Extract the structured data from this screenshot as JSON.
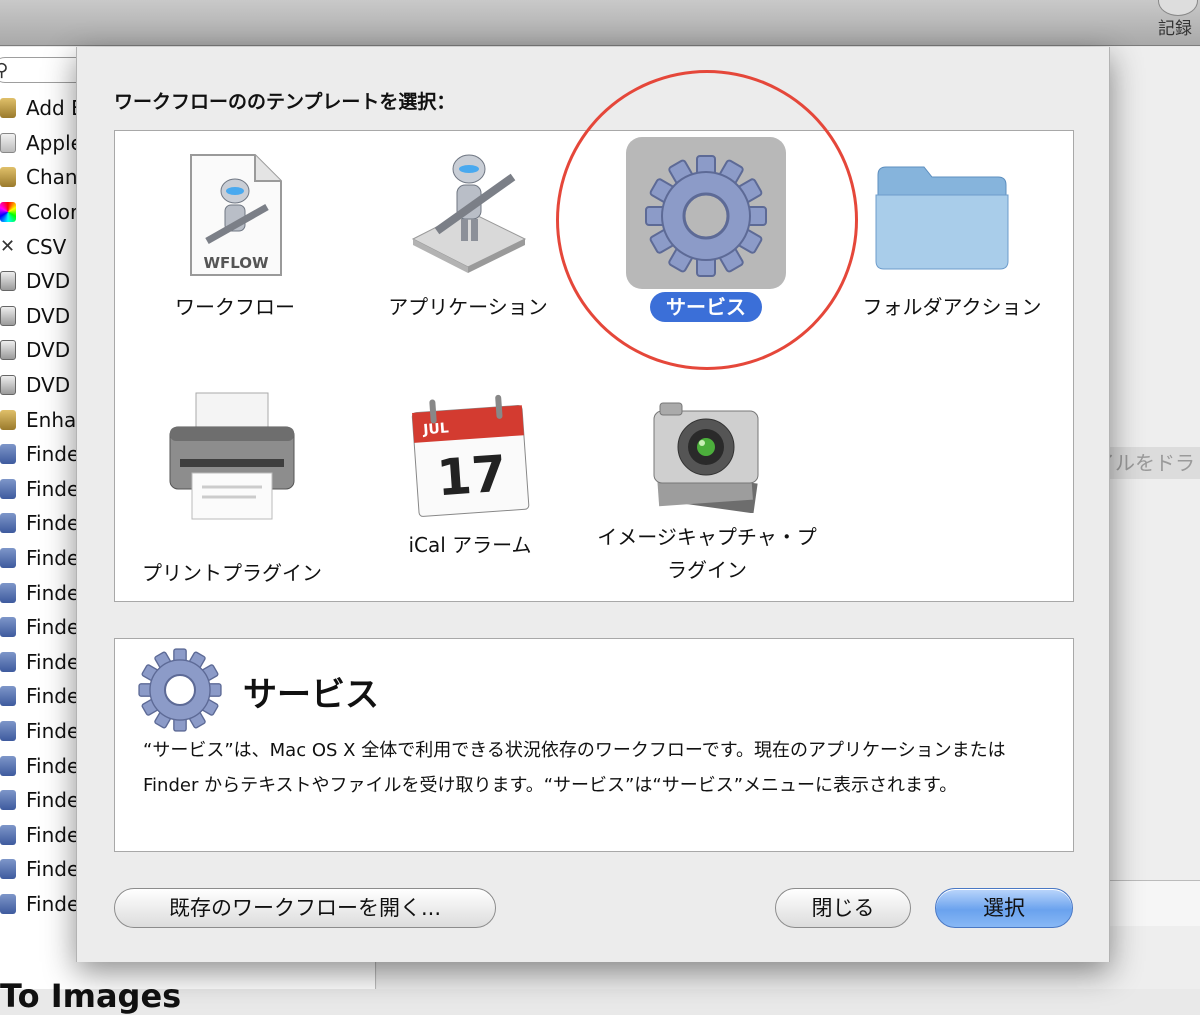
{
  "window": {
    "record_label": "記録"
  },
  "sidebar": {
    "items": [
      {
        "label": "Add E",
        "icon": "robot-icon"
      },
      {
        "label": "Apple",
        "icon": "script-icon"
      },
      {
        "label": "Chang",
        "icon": "robot-icon"
      },
      {
        "label": "Color",
        "icon": "color-icon"
      },
      {
        "label": "CSV",
        "icon": "csv-icon"
      },
      {
        "label": "DVD",
        "icon": "dvd-icon"
      },
      {
        "label": "DVD",
        "icon": "dvd-icon"
      },
      {
        "label": "DVD",
        "icon": "dvd-icon"
      },
      {
        "label": "DVD",
        "icon": "dvd-icon"
      },
      {
        "label": "Enhar",
        "icon": "robot-icon"
      },
      {
        "label": "Finde",
        "icon": "finder-icon"
      },
      {
        "label": "Finde",
        "icon": "finder-icon"
      },
      {
        "label": "Finde",
        "icon": "finder-icon"
      },
      {
        "label": "Finde",
        "icon": "finder-icon"
      },
      {
        "label": "Finde",
        "icon": "finder-icon"
      },
      {
        "label": "Finde",
        "icon": "finder-icon"
      },
      {
        "label": "Finde",
        "icon": "finder-icon"
      },
      {
        "label": "Finde",
        "icon": "finder-icon"
      },
      {
        "label": "Finde",
        "icon": "finder-icon"
      },
      {
        "label": "Finde",
        "icon": "finder-icon"
      },
      {
        "label": "Finde",
        "icon": "finder-icon"
      },
      {
        "label": "Finde",
        "icon": "finder-icon"
      },
      {
        "label": "Finde",
        "icon": "finder-icon"
      },
      {
        "label": "Finde",
        "icon": "finder-icon"
      }
    ],
    "footer_title": "To Images"
  },
  "main": {
    "drop_hint": "ァイルをドラ"
  },
  "dialog": {
    "title": "ワークフローののテンプレートを選択：",
    "templates": [
      {
        "label": "ワークフロー",
        "icon": "workflow-document-icon",
        "badge": "WFLOW"
      },
      {
        "label": "アプリケーション",
        "icon": "application-robot-icon"
      },
      {
        "label": "サービス",
        "icon": "service-gear-icon",
        "selected": true
      },
      {
        "label": "フォルダアクション",
        "icon": "folder-icon"
      },
      {
        "label": "プリントプラグイン",
        "icon": "printer-icon"
      },
      {
        "label": "iCal アラーム",
        "icon": "calendar-icon",
        "month": "JUL",
        "day": "17"
      },
      {
        "label": "イメージキャプチャ・プラグイン",
        "icon": "camera-icon"
      }
    ],
    "description": {
      "title": "サービス",
      "text": "“サービス”は、Mac OS X 全体で利用できる状況依存のワークフローです。現在のアプリケーションまたは Finder からテキストやファイルを受け取ります。“サービス”は“サービス”メニューに表示されます。"
    },
    "buttons": {
      "open_existing": "既存のワークフローを開く...",
      "close": "閉じる",
      "choose": "選択"
    },
    "colors": {
      "selection_blue": "#3b6fd8",
      "annotation_red": "#e5473a"
    }
  }
}
